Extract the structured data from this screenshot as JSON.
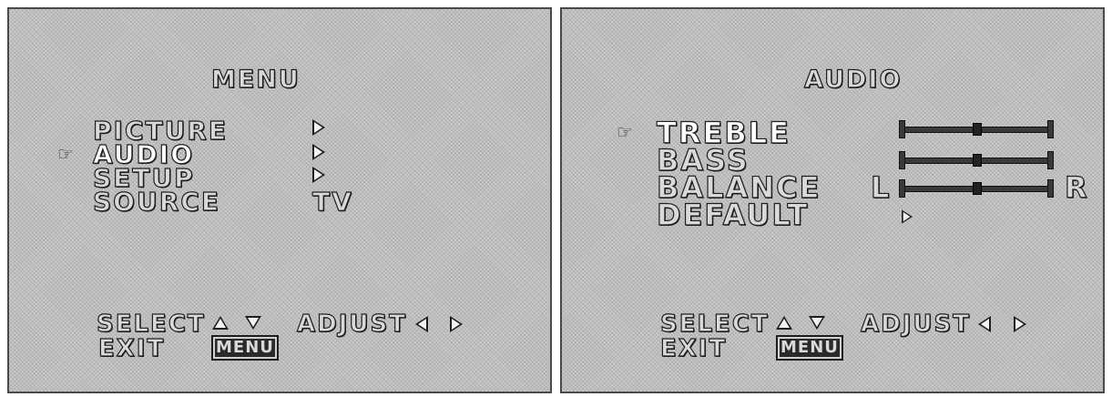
{
  "menu_screen": {
    "title": "MENU",
    "items": [
      {
        "label": "PICTURE",
        "value": ""
      },
      {
        "label": "AUDIO",
        "value": ""
      },
      {
        "label": "SETUP",
        "value": ""
      },
      {
        "label": "SOURCE",
        "value": "TV"
      }
    ],
    "selected_index": 1,
    "footer": {
      "select_label": "SELECT",
      "adjust_label": "ADJUST",
      "exit_label": "EXIT",
      "menu_key": "MENU"
    }
  },
  "audio_screen": {
    "title": "AUDIO",
    "items": [
      {
        "label": "TREBLE"
      },
      {
        "label": "BASS"
      },
      {
        "label": "BALANCE"
      },
      {
        "label": "DEFAULT"
      }
    ],
    "selected_index": 0,
    "balance_left": "L",
    "balance_right": "R",
    "levels": {
      "treble": 0.5,
      "bass": 0.5,
      "balance": 0.5
    },
    "footer": {
      "select_label": "SELECT",
      "adjust_label": "ADJUST",
      "exit_label": "EXIT",
      "menu_key": "MENU"
    }
  },
  "icons": {
    "pointer": "pointing-hand-icon"
  }
}
